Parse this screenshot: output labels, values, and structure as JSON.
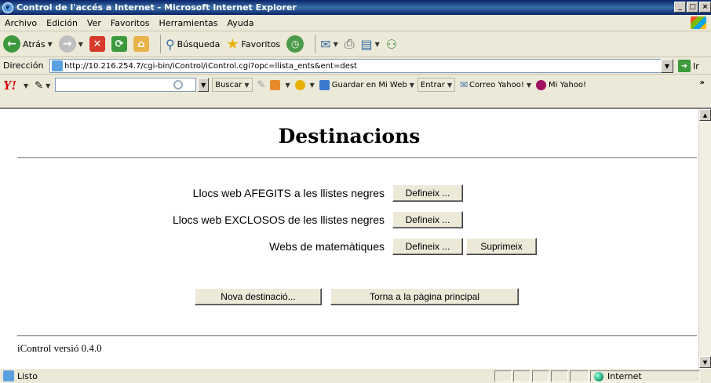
{
  "window": {
    "title": "Control de l'accés a Internet - Microsoft Internet Explorer",
    "controls": [
      "_",
      "□",
      "×"
    ]
  },
  "menu": [
    "Archivo",
    "Edición",
    "Ver",
    "Favoritos",
    "Herramientas",
    "Ayuda"
  ],
  "toolbar": {
    "back_label": "Atrás",
    "search_label": "Búsqueda",
    "favorites_label": "Favoritos"
  },
  "address": {
    "label": "Dirección",
    "url": "http://10.216.254.7/cgi-bin/iControl/iControl.cgi?opc=llista_ents&ent=dest",
    "go_label": "Ir"
  },
  "yahoo": {
    "logo": "Y!",
    "search_label": "Buscar",
    "save_label": "Guardar en Mi Web",
    "enter_label": "Entrar",
    "mail_label": "Correo Yahoo!",
    "my_label": "Mi Yahoo!"
  },
  "page": {
    "title": "Destinacions",
    "rows": [
      {
        "label": "Llocs web AFEGITS a les llistes negres",
        "define": "Defineix ..."
      },
      {
        "label": "Llocs web EXCLOSOS de les llistes negres",
        "define": "Defineix ..."
      },
      {
        "label": "Webs de matemàtiques",
        "define": "Defineix ...",
        "delete": "Suprimeix"
      }
    ],
    "new_button": "Nova destinació...",
    "home_button": "Torna a la pàgina principal",
    "footer": "iControl versió 0.4.0"
  },
  "status": {
    "text": "Listo",
    "zone": "Internet"
  },
  "colors": {
    "titlebar": "#0a246a",
    "chrome": "#ece9d8",
    "content": "#ffffff"
  }
}
